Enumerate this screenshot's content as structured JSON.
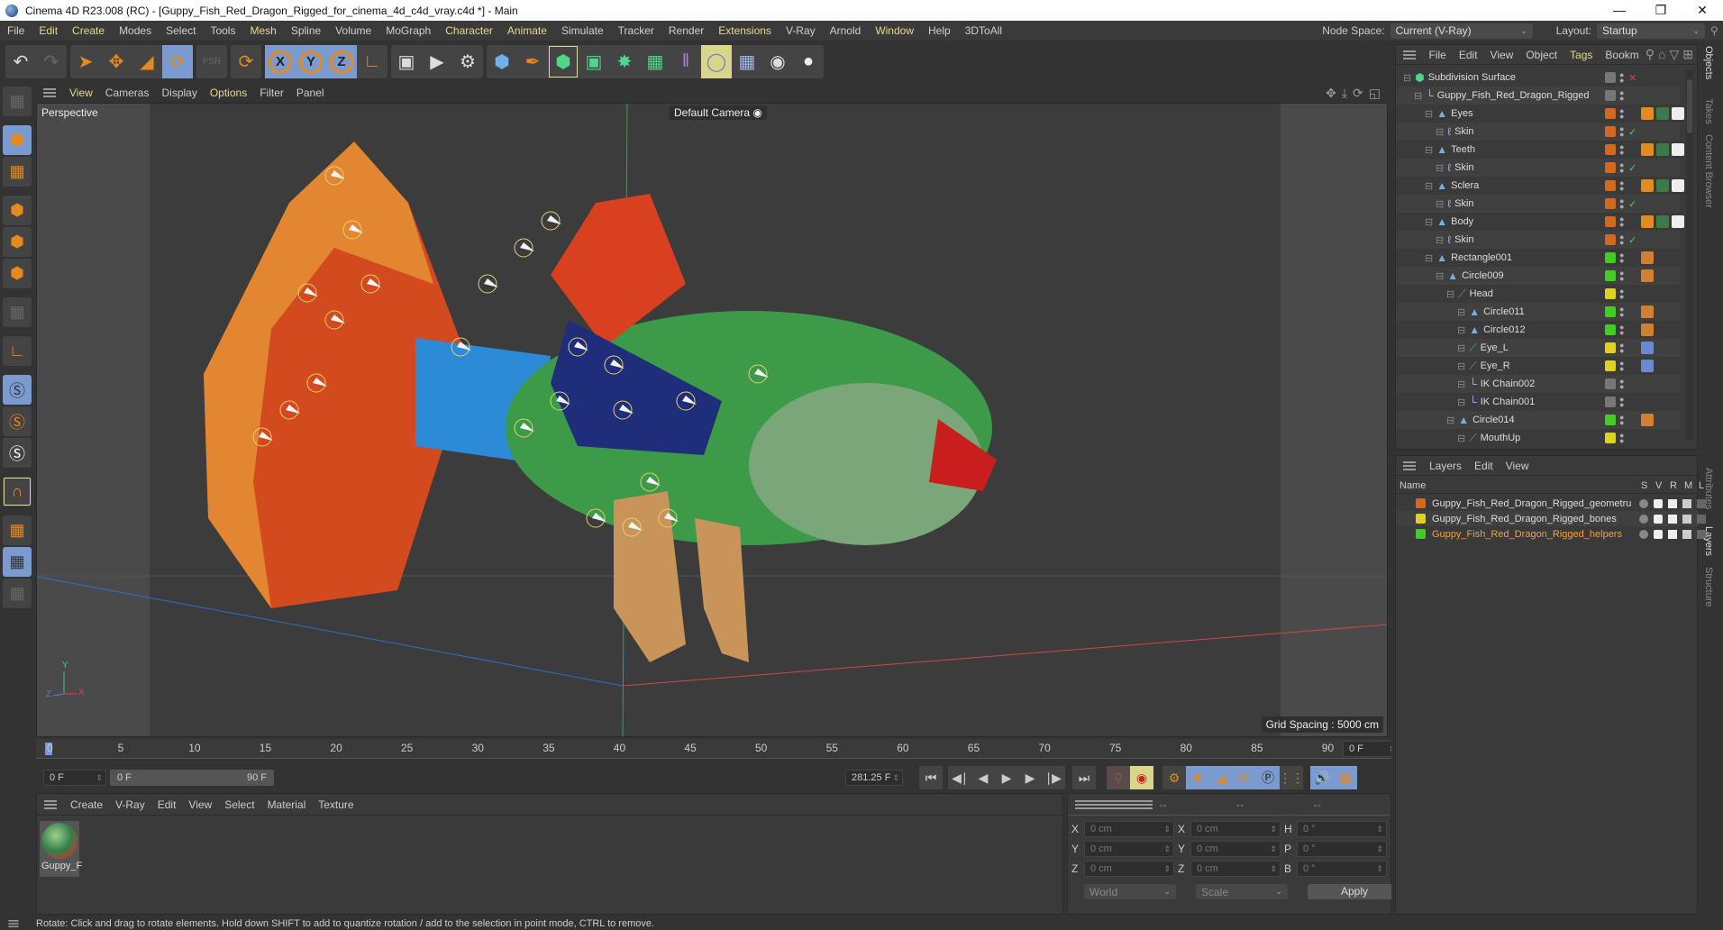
{
  "window": {
    "title": "Cinema 4D R23.008 (RC) - [Guppy_Fish_Red_Dragon_Rigged_for_cinema_4d_c4d_vray.c4d *] - Main",
    "controls": [
      "minimize",
      "restore",
      "close"
    ]
  },
  "menubar": {
    "items": [
      "File",
      "Edit",
      "Create",
      "Modes",
      "Select",
      "Tools",
      "Mesh",
      "Spline",
      "Volume",
      "MoGraph",
      "Character",
      "Animate",
      "Simulate",
      "Tracker",
      "Render",
      "Extensions",
      "V-Ray",
      "Arnold",
      "Window",
      "Help",
      "3DToAll"
    ],
    "highlighted": [
      "Edit",
      "Create",
      "Mesh",
      "Character",
      "Animate",
      "Extensions",
      "Window"
    ],
    "node_space_label": "Node Space:",
    "node_space_value": "Current (V-Ray)",
    "layout_label": "Layout:",
    "layout_value": "Startup"
  },
  "toolbar": {
    "groups": [
      [
        "undo",
        "redo"
      ],
      [
        "live-selection",
        "move",
        "scale",
        "rotate"
      ],
      [
        "psr-lock"
      ],
      [
        "recent-tool"
      ],
      [
        "x-axis",
        "y-axis",
        "z-axis",
        "coordinate-system"
      ],
      [
        "render-view",
        "render-picture-viewer",
        "render-settings"
      ],
      [
        "cube",
        "pen",
        "subdivision-surface",
        "extrude",
        "cloner",
        "mograph-array",
        "symmetry",
        "deformer",
        "floor",
        "camera",
        "light"
      ]
    ],
    "axis_labels": [
      "X",
      "Y",
      "Z"
    ]
  },
  "left_toolbar": {
    "tools": [
      "make-editable",
      "model-mode",
      "texture-mode",
      "points-mode",
      "edges-mode",
      "polygons-mode",
      "uv-mode",
      "axis-mode",
      "solo-off",
      "solo",
      "solo-hierarchy",
      "snap",
      "workplane",
      "locked-workplane",
      "planar-workplane"
    ]
  },
  "viewport": {
    "menu": [
      "View",
      "Cameras",
      "Display",
      "Options",
      "Filter",
      "Panel"
    ],
    "highlighted": [
      "View",
      "Options"
    ],
    "view_name": "Perspective",
    "camera": "Default Camera",
    "grid_spacing": "Grid Spacing : 5000 cm",
    "axis_labels": {
      "x": "X",
      "y": "Y",
      "z": "Z"
    },
    "nav_icons": [
      "move-view-icon",
      "zoom-view-icon",
      "rotate-view-icon",
      "maximize-view-icon"
    ]
  },
  "timeline": {
    "ticks": [
      "0",
      "5",
      "10",
      "15",
      "20",
      "25",
      "30",
      "35",
      "40",
      "45",
      "50",
      "55",
      "60",
      "65",
      "70",
      "75",
      "80",
      "85",
      "90"
    ],
    "current_frame": "0 F",
    "start_field": "0 F",
    "range_start": "0 F",
    "range_end": "90 F",
    "fps_field": "281.25 F"
  },
  "material_manager": {
    "menu": [
      "Create",
      "V-Ray",
      "Edit",
      "View",
      "Select",
      "Material",
      "Texture"
    ],
    "materials": [
      {
        "name": "Guppy_F"
      }
    ]
  },
  "coordinates": {
    "headers": [
      "--",
      "--",
      "--"
    ],
    "rows": [
      {
        "a": "X",
        "av": "0 cm",
        "b": "X",
        "bv": "0 cm",
        "c": "H",
        "cv": "0 °"
      },
      {
        "a": "Y",
        "av": "0 cm",
        "b": "Y",
        "bv": "0 cm",
        "c": "P",
        "cv": "0 °"
      },
      {
        "a": "Z",
        "av": "0 cm",
        "b": "Z",
        "bv": "0 cm",
        "c": "B",
        "cv": "0 °"
      }
    ],
    "space": "World",
    "mode": "Scale",
    "apply": "Apply"
  },
  "object_manager": {
    "menu": [
      "File",
      "Edit",
      "View",
      "Object",
      "Tags",
      "Bookm"
    ],
    "highlighted": [
      "Tags"
    ],
    "objects": [
      {
        "name": "Subdivision Surface",
        "depth": 0,
        "icon": "subdivision",
        "layer": "none",
        "extra": "x",
        "tags": []
      },
      {
        "name": "Guppy_Fish_Red_Dragon_Rigged",
        "depth": 1,
        "icon": "null",
        "layer": "none",
        "extra": "",
        "tags": []
      },
      {
        "name": "Eyes",
        "depth": 2,
        "icon": "polygon",
        "layer": "#d2691e",
        "extra": "",
        "tags": [
          "weight",
          "material",
          "checker"
        ]
      },
      {
        "name": "Skin",
        "depth": 3,
        "icon": "skin",
        "layer": "#d2691e",
        "extra": "check",
        "tags": []
      },
      {
        "name": "Teeth",
        "depth": 2,
        "icon": "polygon",
        "layer": "#d2691e",
        "extra": "",
        "tags": [
          "weight",
          "material",
          "checker"
        ]
      },
      {
        "name": "Skin",
        "depth": 3,
        "icon": "skin",
        "layer": "#d2691e",
        "extra": "check",
        "tags": []
      },
      {
        "name": "Sclera",
        "depth": 2,
        "icon": "polygon",
        "layer": "#d2691e",
        "extra": "",
        "tags": [
          "weight",
          "material",
          "checker"
        ]
      },
      {
        "name": "Skin",
        "depth": 3,
        "icon": "skin",
        "layer": "#d2691e",
        "extra": "check",
        "tags": []
      },
      {
        "name": "Body",
        "depth": 2,
        "icon": "polygon",
        "layer": "#d2691e",
        "extra": "",
        "tags": [
          "weight",
          "material",
          "checker"
        ]
      },
      {
        "name": "Skin",
        "depth": 3,
        "icon": "skin",
        "layer": "#d2691e",
        "extra": "check",
        "tags": []
      },
      {
        "name": "Rectangle001",
        "depth": 2,
        "icon": "polygon",
        "layer": "#44cc22",
        "extra": "",
        "tags": [
          "xpresso"
        ]
      },
      {
        "name": "Circle009",
        "depth": 3,
        "icon": "polygon",
        "layer": "#44cc22",
        "extra": "",
        "tags": [
          "xpresso"
        ]
      },
      {
        "name": "Head",
        "depth": 4,
        "icon": "joint",
        "layer": "#e0d020",
        "extra": "",
        "tags": []
      },
      {
        "name": "Circle011",
        "depth": 5,
        "icon": "polygon",
        "layer": "#44cc22",
        "extra": "",
        "tags": [
          "xpresso"
        ]
      },
      {
        "name": "Circle012",
        "depth": 5,
        "icon": "polygon",
        "layer": "#44cc22",
        "extra": "",
        "tags": [
          "xpresso"
        ]
      },
      {
        "name": "Eye_L",
        "depth": 5,
        "icon": "joint",
        "layer": "#e0d020",
        "extra": "",
        "tags": [
          "constraint"
        ]
      },
      {
        "name": "Eye_R",
        "depth": 5,
        "icon": "joint",
        "layer": "#e0d020",
        "extra": "",
        "tags": [
          "constraint"
        ]
      },
      {
        "name": "IK Chain002",
        "depth": 5,
        "icon": "null",
        "layer": "none",
        "extra": "",
        "tags": []
      },
      {
        "name": "IK Chain001",
        "depth": 5,
        "icon": "null",
        "layer": "none",
        "extra": "",
        "tags": []
      },
      {
        "name": "Circle014",
        "depth": 4,
        "icon": "polygon",
        "layer": "#44cc22",
        "extra": "",
        "tags": [
          "xpresso"
        ]
      },
      {
        "name": "MouthUp",
        "depth": 5,
        "icon": "joint",
        "layer": "#e0d020",
        "extra": "",
        "tags": []
      }
    ]
  },
  "layer_manager": {
    "menu": [
      "Layers",
      "Edit",
      "View"
    ],
    "columns": [
      "Name",
      "S",
      "V",
      "R",
      "M",
      "L"
    ],
    "layers": [
      {
        "name": "Guppy_Fish_Red_Dragon_Rigged_geometru",
        "color": "#d2691e",
        "active": false
      },
      {
        "name": "Guppy_Fish_Red_Dragon_Rigged_bones",
        "color": "#e0d020",
        "active": false
      },
      {
        "name": "Guppy_Fish_Red_Dragon_Rigged_helpers",
        "color": "#44cc22",
        "active": true
      }
    ]
  },
  "side_tabs": {
    "top": [
      "Objects",
      "Takes",
      "Content Browser"
    ],
    "bottom": [
      "Attributes",
      "Layers",
      "Structure"
    ],
    "active": [
      "Objects",
      "Layers"
    ]
  },
  "status": {
    "text": "Rotate: Click and drag to rotate elements. Hold down SHIFT to add to quantize rotation / add to the selection in point mode, CTRL to remove."
  },
  "colors": {
    "accent_orange": "#e48a1f",
    "active_blue": "#7b9ad0",
    "highlight_yellow": "#e7d98d",
    "layer_active_text": "#f0a040"
  }
}
